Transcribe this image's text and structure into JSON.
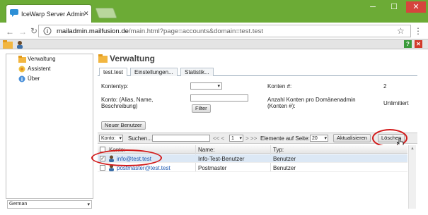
{
  "browser": {
    "tab_title": "IceWarp Server Administ",
    "url_host": "mailadmin.mailfusion.de",
    "url_path": "/main.html?page=accounts&domain=test.test",
    "minimize_glyph": "─",
    "maximize_glyph": "☐",
    "close_glyph": "✕"
  },
  "sidebar": {
    "items": [
      {
        "label": "Verwaltung",
        "icon": "folder-icon"
      },
      {
        "label": "Assistent",
        "icon": "wand-icon"
      },
      {
        "label": "Über",
        "icon": "info-icon"
      }
    ],
    "language": "German"
  },
  "main": {
    "heading": "Verwaltung",
    "tabs": [
      {
        "label": "test.test",
        "active": true
      },
      {
        "label": "Einstellungen...",
        "active": false
      },
      {
        "label": "Statistik...",
        "active": false
      }
    ],
    "form": {
      "account_type_label": "Kontentyp:",
      "account_filter_label_1": "Konto: (Alias, Name,",
      "account_filter_label_2": "Beschreibung)",
      "filter_button": "Filter",
      "accounts_count_label": "Konten #:",
      "accounts_count_value": "2",
      "per_admin_label_1": "Anzahl Konten pro Domänenadmin",
      "per_admin_label_2": "(Konten #):",
      "per_admin_value": "Unlimitiert"
    },
    "new_user_button": "Neuer Benutzer",
    "toolbar": {
      "column_select": "Konto:",
      "search_label": "Suchen...",
      "pager_prev": "<< <",
      "page_value": "1",
      "pager_next": "> >>",
      "per_page_label": "Elemente auf Seite:",
      "per_page_value": "20",
      "refresh_button": "Aktualisieren",
      "delete_button": "Löschen"
    },
    "table": {
      "headers": [
        "Konto:",
        "Name:",
        "Typ:"
      ],
      "rows": [
        {
          "account": "info@test.test",
          "name": "Info-Test-Benutzer",
          "type": "Benutzer",
          "checked": true
        },
        {
          "account": "postmaster@test.test",
          "name": "Postmaster",
          "type": "Benutzer",
          "checked": false
        }
      ]
    }
  },
  "colors": {
    "chrome_green": "#6cab36",
    "highlight_red": "#d21b1b",
    "link_blue": "#1a56b0"
  }
}
